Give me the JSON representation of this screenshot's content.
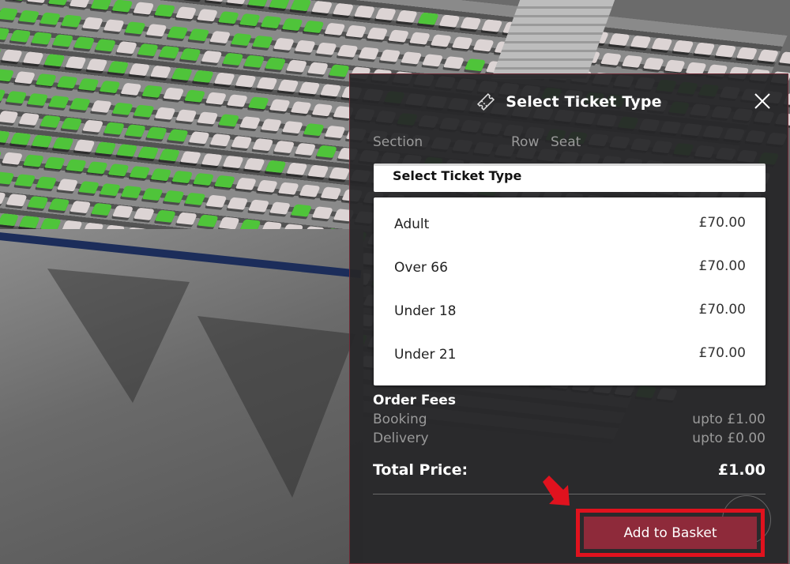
{
  "modal": {
    "title": "Select Ticket Type",
    "icon": "ticket-icon",
    "close_icon": "close-icon",
    "columns": {
      "section": "Section",
      "row": "Row",
      "seat": "Seat"
    },
    "select_placeholder": "Select Ticket Type",
    "options": [
      {
        "label": "Adult",
        "price": "£70.00"
      },
      {
        "label": "Over 66",
        "price": "£70.00"
      },
      {
        "label": "Under 18",
        "price": "£70.00"
      },
      {
        "label": "Under 21",
        "price": "£70.00"
      }
    ],
    "order_fees": {
      "title": "Order Fees",
      "items": [
        {
          "label": "Booking",
          "value": "upto £1.00"
        },
        {
          "label": "Delivery",
          "value": "upto £0.00"
        }
      ]
    },
    "total": {
      "label": "Total Price:",
      "value": "£1.00"
    },
    "add_button": "Add to Basket"
  },
  "colors": {
    "accent": "#8e2a3a",
    "highlight": "#e0121e",
    "seat_available": "#4fc43a",
    "seat_unavailable": "#dcd4d4"
  }
}
